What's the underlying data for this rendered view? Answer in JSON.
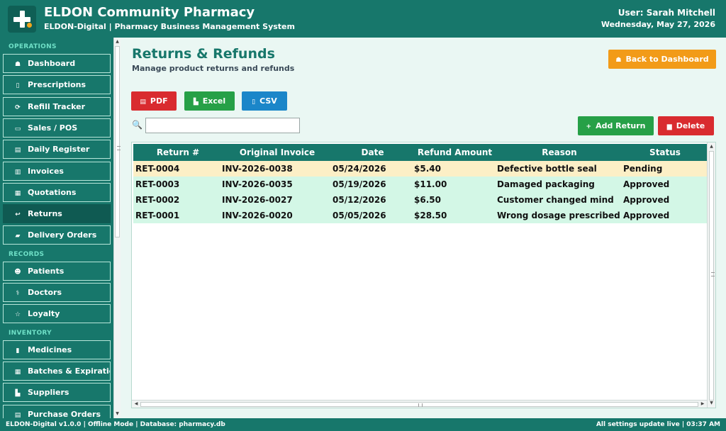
{
  "header": {
    "title": "ELDON Community Pharmacy",
    "subtitle": "ELDON-Digital  |  Pharmacy Business Management System",
    "user": "User: Sarah Mitchell",
    "date": "Wednesday, May 27, 2026"
  },
  "sidebar": {
    "sections": [
      {
        "label": "OPERATIONS",
        "items": [
          {
            "label": "Dashboard",
            "icon": "home-icon",
            "glyph": "☗"
          },
          {
            "label": "Prescriptions",
            "icon": "clipboard-icon",
            "glyph": "▯"
          },
          {
            "label": "Refill Tracker",
            "icon": "refresh-icon",
            "glyph": "⟳"
          },
          {
            "label": "Sales / POS",
            "icon": "credit-card-icon",
            "glyph": "▭"
          },
          {
            "label": "Daily Register",
            "icon": "register-icon",
            "glyph": "▤"
          },
          {
            "label": "Invoices",
            "icon": "invoice-icon",
            "glyph": "▥"
          },
          {
            "label": "Quotations",
            "icon": "quotation-icon",
            "glyph": "▦"
          },
          {
            "label": "Returns",
            "icon": "return-arrow-icon",
            "glyph": "↩",
            "active": true
          },
          {
            "label": "Delivery Orders",
            "icon": "truck-icon",
            "glyph": "▰"
          }
        ]
      },
      {
        "label": "RECORDS",
        "items": [
          {
            "label": "Patients",
            "icon": "users-icon",
            "glyph": "☻"
          },
          {
            "label": "Doctors",
            "icon": "stethoscope-icon",
            "glyph": "⚕"
          },
          {
            "label": "Loyalty",
            "icon": "star-icon",
            "glyph": "☆"
          }
        ]
      },
      {
        "label": "INVENTORY",
        "items": [
          {
            "label": "Medicines",
            "icon": "pill-icon",
            "glyph": "▮"
          },
          {
            "label": "Batches & Expiration",
            "icon": "boxes-icon",
            "glyph": "▦"
          },
          {
            "label": "Suppliers",
            "icon": "factory-icon",
            "glyph": "▙"
          },
          {
            "label": "Purchase Orders",
            "icon": "cart-icon",
            "glyph": "▤"
          }
        ]
      }
    ]
  },
  "main": {
    "title": "Returns & Refunds",
    "subtitle": "Manage product returns and refunds",
    "back_button": "Back to Dashboard",
    "export": {
      "pdf": "PDF",
      "excel": "Excel",
      "csv": "CSV"
    },
    "add_button": "Add Return",
    "delete_button": "Delete",
    "search": {
      "value": "",
      "placeholder": ""
    },
    "table": {
      "columns": [
        "Return #",
        "Original Invoice",
        "Date",
        "Refund Amount",
        "Reason",
        "Status"
      ],
      "rows": [
        {
          "return_no": "RET-0004",
          "invoice": "INV-2026-0038",
          "date": "05/24/2026",
          "amount": "$5.40",
          "reason": "Defective bottle seal",
          "status": "Pending"
        },
        {
          "return_no": "RET-0003",
          "invoice": "INV-2026-0035",
          "date": "05/19/2026",
          "amount": "$11.00",
          "reason": "Damaged packaging",
          "status": "Approved"
        },
        {
          "return_no": "RET-0002",
          "invoice": "INV-2026-0027",
          "date": "05/12/2026",
          "amount": "$6.50",
          "reason": "Customer changed mind",
          "status": "Approved"
        },
        {
          "return_no": "RET-0001",
          "invoice": "INV-2026-0020",
          "date": "05/05/2026",
          "amount": "$28.50",
          "reason": "Wrong dosage prescribed",
          "status": "Approved"
        }
      ]
    }
  },
  "footer": {
    "left": "ELDON-Digital v1.0.0  |  Offline Mode  |  Database: pharmacy.db",
    "right": "All settings update live   |   03:37 AM"
  },
  "colors": {
    "brand": "#17776b",
    "active_nav": "#0f5a52",
    "accent_orange": "#f29b18",
    "danger": "#d92b2f",
    "success": "#26a047",
    "info": "#1b86c9",
    "row_pending": "#fcefc6",
    "row_approved": "#d3f7e6"
  }
}
